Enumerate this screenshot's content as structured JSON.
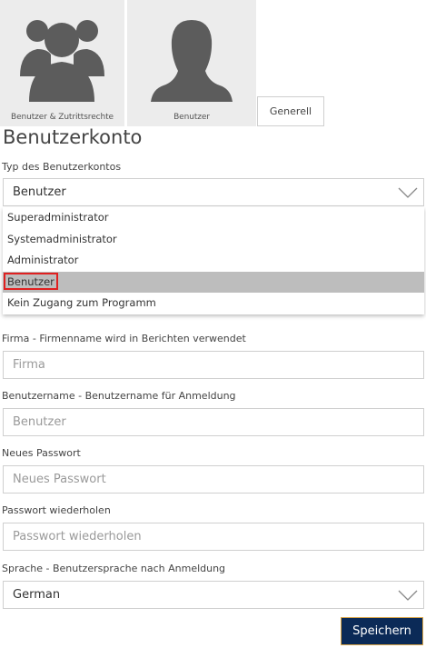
{
  "tiles": {
    "users_access": "Benutzer & Zutrittsrechte",
    "user": "Benutzer"
  },
  "tab_general": "Generell",
  "page_title": "Benutzerkonto",
  "account_type": {
    "label": "Typ des Benutzerkontos",
    "value": "Benutzer",
    "options": [
      "Superadministrator",
      "Systemadministrator",
      "Administrator",
      "Benutzer",
      "Kein Zugang zum Programm"
    ],
    "selected_index": 3
  },
  "company": {
    "label": "Firma - Firmenname wird in Berichten verwendet",
    "placeholder": "Firma"
  },
  "username": {
    "label": "Benutzername - Benutzername für Anmeldung",
    "placeholder": "Benutzer"
  },
  "new_password": {
    "label": "Neues Passwort",
    "placeholder": "Neues Passwort"
  },
  "repeat_password": {
    "label": "Passwort wiederholen",
    "placeholder": "Passwort wiederholen"
  },
  "language": {
    "label": "Sprache - Benutzersprache nach Anmeldung",
    "value": "German"
  },
  "save_label": "Speichern",
  "colors": {
    "save_bg": "#0b2a57",
    "highlight": "#e02020",
    "selected_bg": "#bdbdbd"
  }
}
